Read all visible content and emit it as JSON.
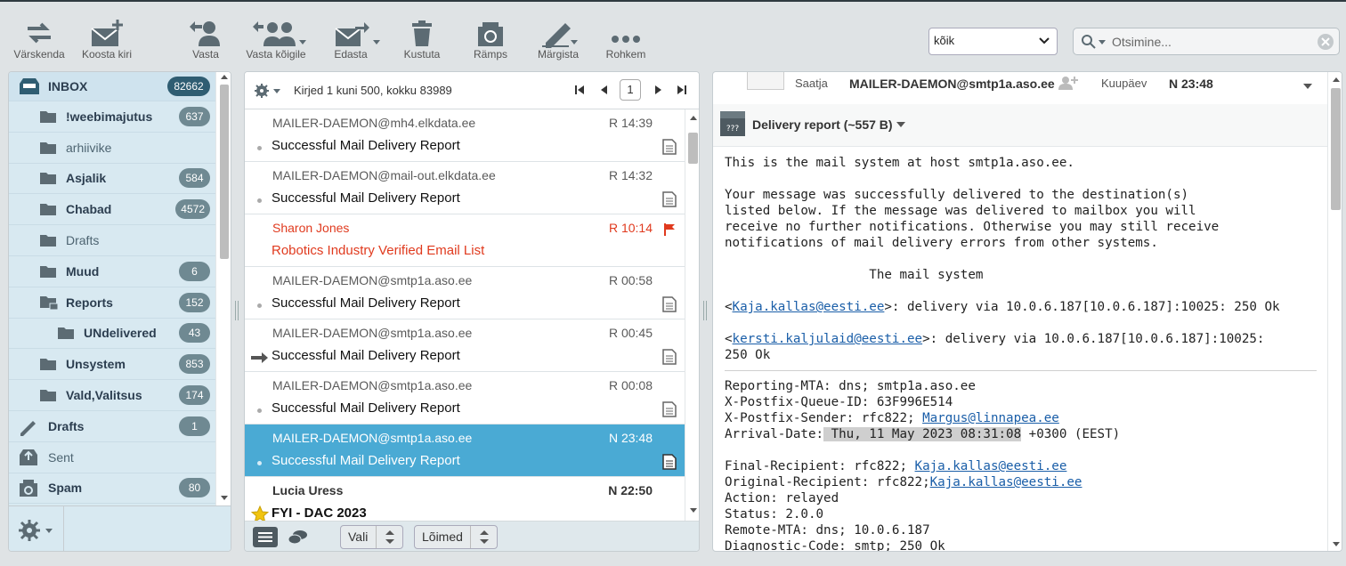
{
  "toolbar": {
    "refresh": "Värskenda",
    "compose": "Koosta kiri",
    "reply": "Vasta",
    "reply_all": "Vasta kõigile",
    "forward": "Edasta",
    "delete": "Kustuta",
    "junk": "Rämps",
    "mark": "Märgista",
    "more": "Rohkem",
    "filter_value": "kõik",
    "search_placeholder": "Otsimine..."
  },
  "folders": [
    {
      "name": "INBOX",
      "count": "82662"
    },
    {
      "name": "!weebimajutus",
      "count": "637"
    },
    {
      "name": "arhiivike",
      "count": ""
    },
    {
      "name": "Asjalik",
      "count": "584"
    },
    {
      "name": "Chabad",
      "count": "4572"
    },
    {
      "name": "Drafts",
      "count": ""
    },
    {
      "name": "Muud",
      "count": "6"
    },
    {
      "name": "Reports",
      "count": "152"
    },
    {
      "name": "UNdelivered",
      "count": "43"
    },
    {
      "name": "Unsystem",
      "count": "853"
    },
    {
      "name": "Vald,Valitsus",
      "count": "174"
    },
    {
      "name": "Drafts",
      "count": "1"
    },
    {
      "name": "Sent",
      "count": ""
    },
    {
      "name": "Spam",
      "count": "80"
    }
  ],
  "message_list": {
    "count_text": "Kirjed 1 kuni 500, kokku 83989",
    "page": "1",
    "messages": [
      {
        "from": "MAILER-DAEMON@mh4.elkdata.ee",
        "date": "R 14:39",
        "subject": "Successful Mail Delivery Report"
      },
      {
        "from": "MAILER-DAEMON@mail-out.elkdata.ee",
        "date": "R 14:32",
        "subject": "Successful Mail Delivery Report"
      },
      {
        "from": "Sharon Jones",
        "date": "R 10:14",
        "subject": "Robotics Industry Verified Email List"
      },
      {
        "from": "MAILER-DAEMON@smtp1a.aso.ee",
        "date": "R 00:58",
        "subject": "Successful Mail Delivery Report"
      },
      {
        "from": "MAILER-DAEMON@smtp1a.aso.ee",
        "date": "R 00:45",
        "subject": "Successful Mail Delivery Report"
      },
      {
        "from": "MAILER-DAEMON@smtp1a.aso.ee",
        "date": "R 00:08",
        "subject": "Successful Mail Delivery Report"
      },
      {
        "from": "MAILER-DAEMON@smtp1a.aso.ee",
        "date": "N 23:48",
        "subject": "Successful Mail Delivery Report"
      },
      {
        "from": "Lucia Uress",
        "date": "N 22:50",
        "subject": "FYI - DAC 2023"
      }
    ],
    "footer_select": "Vali",
    "footer_threads": "Lõimed"
  },
  "preview": {
    "from_label": "Saatja",
    "from_value": "MAILER-DAEMON@smtp1a.aso.ee",
    "date_label": "Kuupäev",
    "date_value": "N 23:48",
    "part_name": "Delivery report (~557 B)",
    "body": {
      "p1": "This is the mail system at host smtp1a.aso.ee.",
      "p2_1": "Your message was successfully delivered to the destination(s)",
      "p2_2": "listed below. If the message was delivered to mailbox you will",
      "p2_3": "receive no further notifications. Otherwise you may still receive",
      "p2_4": "notifications of mail delivery errors from other systems.",
      "sig": "                   The mail system",
      "r1_addr": "Kaja.kallas@eesti.ee",
      "r1_rest": ">: delivery via 10.0.6.187[10.0.6.187]:10025: 250 Ok",
      "r2_addr": "kersti.kaljulaid@eesti.ee",
      "r2_rest": ">: delivery via 10.0.6.187[10.0.6.187]:10025:",
      "r2_line2": "250 Ok",
      "h1": "Reporting-MTA: dns; smtp1a.aso.ee",
      "h2": "X-Postfix-Queue-ID: 63F996E514",
      "h3_pre": "X-Postfix-Sender: rfc822; ",
      "h3_addr": "Margus@linnapea.ee",
      "h4_pre": "Arrival-Date:",
      "h4_hl": " Thu, 11 May 2023 08:31:08",
      "h4_post": " +0300 (EEST)",
      "h5_pre": "Final-Recipient: rfc822; ",
      "h5_addr": "Kaja.kallas@eesti.ee",
      "h6_pre": "Original-Recipient: rfc822;",
      "h6_addr": "Kaja.kallas@eesti.ee",
      "h7": "Action: relayed",
      "h8": "Status: 2.0.0",
      "h9": "Remote-MTA: dns; 10.0.6.187",
      "h10": "Diagnostic-Code: smtp; 250 Ok"
    }
  }
}
